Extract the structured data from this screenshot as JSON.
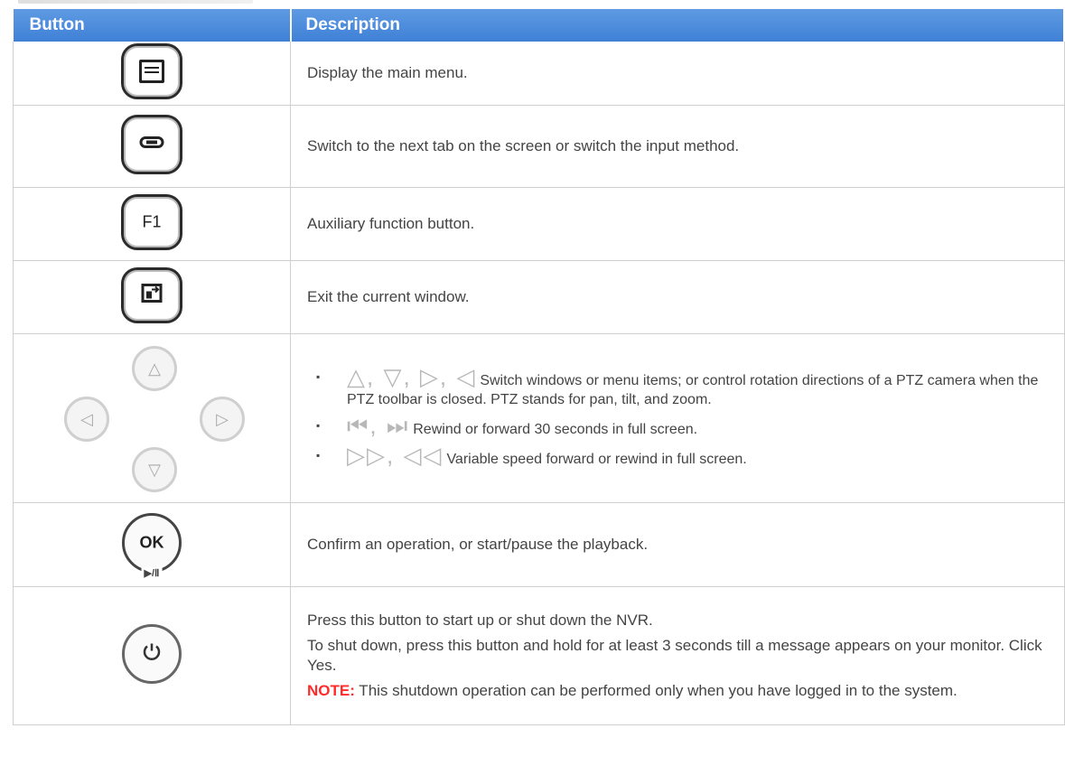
{
  "header": {
    "button": "Button",
    "description": "Description"
  },
  "rows": [
    {
      "icon": "menu-icon",
      "desc": "Display the main menu."
    },
    {
      "icon": "tab-switch-icon",
      "desc": "Switch to the next tab on the screen or switch the input method."
    },
    {
      "icon": "f1-key-icon",
      "key_label": "F1",
      "desc": "Auxiliary function button."
    },
    {
      "icon": "exit-icon",
      "desc": "Exit the current window."
    },
    {
      "icon": "direction-pad-icon",
      "bullets": [
        {
          "glyphs": "△, ▽, ▷, ◁",
          "text": "Switch windows or menu items; or control rotation directions of a PTZ camera when the PTZ toolbar is closed. PTZ stands for pan, tilt, and zoom."
        },
        {
          "glyphs": "⏮, ⏭",
          "text": "Rewind or forward 30 seconds in full screen."
        },
        {
          "glyphs": "▷▷, ◁◁",
          "text": "Variable speed forward or rewind in full screen."
        }
      ]
    },
    {
      "icon": "ok-play-pause-icon",
      "key_label": "OK",
      "sub_label": "▶/Ⅱ",
      "desc": "Confirm an operation, or start/pause the playback."
    },
    {
      "icon": "power-icon",
      "p1": "Press this button to start up or shut down the NVR.",
      "p2": "To shut down, press this button and hold for at least 3 seconds till a message appears on your monitor. Click Yes.",
      "note_label": "NOTE:",
      "note_text": " This shutdown operation can be performed only when you have logged in to the system."
    }
  ]
}
